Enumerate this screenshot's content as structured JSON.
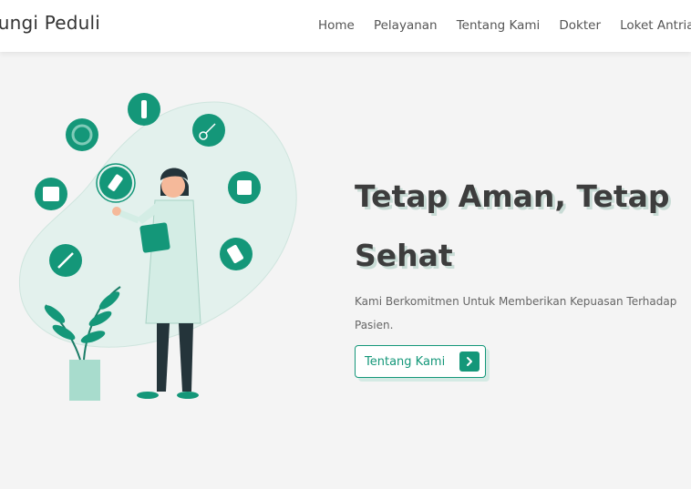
{
  "brand": {
    "name": "lungi Peduli"
  },
  "nav": {
    "items": [
      "Home",
      "Pelayanan",
      "Tentang Kami",
      "Dokter",
      "Loket Antrian"
    ]
  },
  "hero": {
    "title_line1": "Tetap Aman, Tetap",
    "title_line2": "Sehat",
    "subtitle_line1": "Kami Berkomitmen Untuk Memberikan Kepuasan Terhadap",
    "subtitle_line2": "Pasien.",
    "cta_label": "Tentang Kami",
    "cta_icon": "chevron-right-icon"
  },
  "colors": {
    "primary": "#149779",
    "blob": "#e3f1ed",
    "text_dark": "#3d3d3d"
  }
}
